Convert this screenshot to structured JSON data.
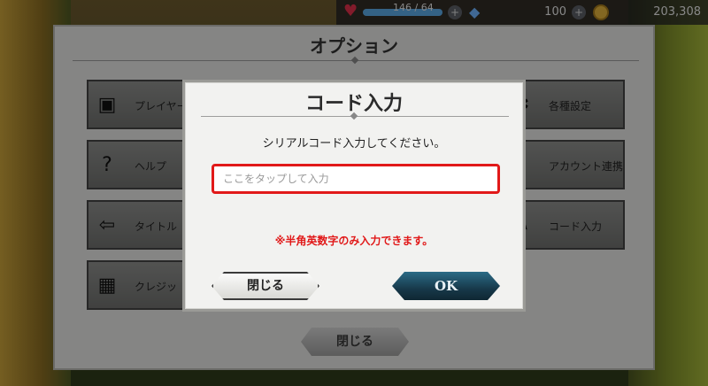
{
  "hud": {
    "hp_text": "146 / 64",
    "gems": "100",
    "coins": "203,308"
  },
  "options": {
    "title": "オプション",
    "buttons": [
      {
        "label": "プレイヤー"
      },
      {
        "label": "ヘルプ"
      },
      {
        "label": "タイトル"
      },
      {
        "label": "クレジッ"
      },
      {
        "label": "各種設定"
      },
      {
        "label": "アカウント連携"
      },
      {
        "label": "コード入力"
      }
    ],
    "close_label": "閉じる"
  },
  "dialog": {
    "title": "コード入力",
    "message": "シリアルコード入力してください。",
    "input_placeholder": "ここをタップして入力",
    "input_value": "",
    "note": "※半角英数字のみ入力できます。",
    "close_label": "閉じる",
    "ok_label": "OK"
  }
}
